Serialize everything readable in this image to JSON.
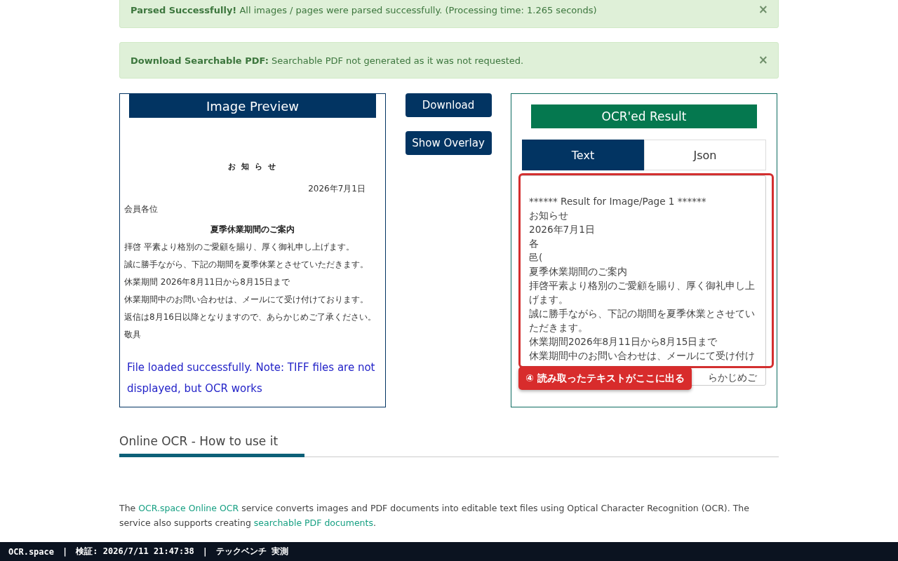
{
  "alerts": [
    {
      "label": "Parsed Successfully!",
      "text": "All images / pages were parsed successfully. (Processing time: 1.265 seconds)",
      "close": "×"
    },
    {
      "label": "Download Searchable PDF:",
      "text": "Searchable PDF not generated as it was not requested.",
      "close": "×"
    }
  ],
  "preview": {
    "title": "Image Preview",
    "document": {
      "title": "お 知 ら せ",
      "date": "2026年7月1日",
      "addressee": "会員各位",
      "subject": "夏季休業期間のご案内",
      "lines": [
        "拝啓 平素より格別のご愛顧を賜り、厚く御礼申し上げます。",
        "誠に勝手ながら、下記の期間を夏季休業とさせていただきます。",
        "休業期間 2026年8月11日から8月15日まで",
        "休業期間中のお問い合わせは、メールにて受け付けております。",
        "返信は8月16日以降となりますので、あらかじめご了承ください。",
        "敬具"
      ]
    },
    "note": "File loaded successfully. Note: TIFF files are not displayed, but OCR works"
  },
  "actions": [
    "Download",
    "Show Overlay"
  ],
  "result": {
    "title": "OCR'ed Result",
    "tabs": [
      {
        "label": "Text",
        "selected": true
      },
      {
        "label": "Json",
        "selected": false
      }
    ],
    "lines": [
      "****** Result for Image/Page 1 ******",
      "お知らせ",
      "2026年7月1日",
      "各",
      "邑(",
      "夏季休業期間のご案内",
      "拝啓平素より格別のご愛顧を賜り、厚く御礼申し上",
      "げます。",
      "誠に勝手ながら、下記の期間を夏季休業とさせてい",
      "ただきます。",
      "休業期間2026年8月11日から8月15日まで",
      "休業期間中のお問い合わせは、メールにて受け付け"
    ],
    "partial_line": "らかじめご",
    "callout": "④ 読み取ったテキストがここに出る"
  },
  "howto": {
    "heading": "Online OCR - How to use it",
    "paragraph": [
      {
        "text": "The ",
        "link": false
      },
      {
        "text": "OCR.space Online OCR",
        "link": true
      },
      {
        "text": " service converts images and PDF documents into editable text files using Optical Character Recognition (OCR). The service also supports creating ",
        "link": false
      },
      {
        "text": "searchable PDF documents",
        "link": true
      },
      {
        "text": ".",
        "link": false
      }
    ]
  },
  "footer": [
    "OCR.space",
    "|",
    "検証: 2026/7/11 21:47:38",
    "|",
    "テックベンチ 実測"
  ]
}
